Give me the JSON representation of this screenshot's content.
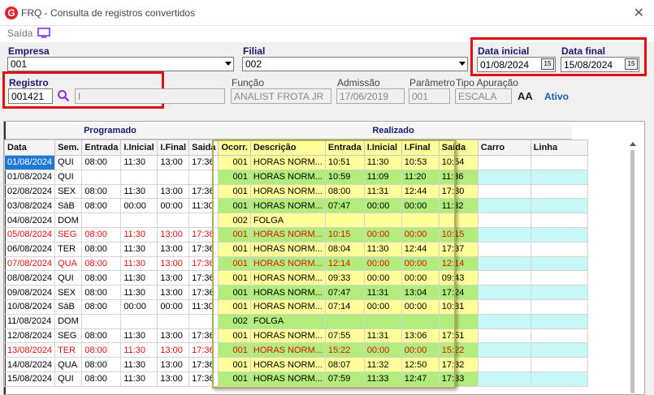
{
  "window": {
    "title": "FRQ - Consulta de registros convertidos",
    "app_icon": "G"
  },
  "toolbar": {
    "saida": "Saída"
  },
  "form": {
    "empresa_label": "Empresa",
    "empresa_value": "001",
    "filial_label": "Filial",
    "filial_value": "002",
    "data_inicial_label": "Data inicial",
    "data_inicial_value": "01/08/2024",
    "data_final_label": "Data final",
    "data_final_value": "15/08/2024",
    "registro_label": "Registro",
    "registro_value": "001421",
    "nome_value": "I",
    "funcao_label": "Função",
    "funcao_value": "ANALIST FROTA JR",
    "admissao_label": "Admissão",
    "admissao_value": "17/06/2019",
    "parametro_label": "Parâmetro",
    "parametro_value": "001",
    "tipo_label": "Tipo Apuração",
    "tipo_value": "ESCALA",
    "status": "Ativo",
    "cal_icon": "15"
  },
  "grid": {
    "group_programado": "Programado",
    "group_realizado": "Realizado",
    "headers": [
      "Data",
      "Sem.",
      "Entrada",
      "I.Inicial",
      "I.Final",
      "Saida",
      "Ocorr.",
      "Descrição",
      "Entrada",
      "I.Inicial",
      "I.Final",
      "Saida",
      "Carro",
      "Linha"
    ],
    "rows": [
      {
        "data": "01/08/2024",
        "sem": "QUI",
        "pe": "08:00",
        "pi": "11:30",
        "pf": "13:00",
        "ps": "17:36",
        "oc": "001",
        "desc": "HORAS NORM...",
        "re": "10:51",
        "ri": "11:30",
        "rf": "10:53",
        "rs": "10:54",
        "red": false,
        "sel": true
      },
      {
        "data": "01/08/2024",
        "sem": "QUI",
        "pe": "",
        "pi": "",
        "pf": "",
        "ps": "",
        "oc": "001",
        "desc": "HORAS NORM...",
        "re": "10:59",
        "ri": "11:09",
        "rf": "11:20",
        "rs": "11:36",
        "red": false
      },
      {
        "data": "02/08/2024",
        "sem": "SEX",
        "pe": "08:00",
        "pi": "11:30",
        "pf": "13:00",
        "ps": "17:36",
        "oc": "001",
        "desc": "HORAS NORM...",
        "re": "08:00",
        "ri": "11:31",
        "rf": "12:44",
        "rs": "17:30",
        "red": false
      },
      {
        "data": "03/08/2024",
        "sem": "SáB",
        "pe": "08:00",
        "pi": "00:00",
        "pf": "00:00",
        "ps": "11:30",
        "oc": "001",
        "desc": "HORAS NORM...",
        "re": "07:47",
        "ri": "00:00",
        "rf": "00:00",
        "rs": "11:32",
        "red": false
      },
      {
        "data": "04/08/2024",
        "sem": "DOM",
        "pe": "",
        "pi": "",
        "pf": "",
        "ps": "",
        "oc": "002",
        "desc": "FOLGA",
        "re": "",
        "ri": "",
        "rf": "",
        "rs": "",
        "red": false
      },
      {
        "data": "05/08/2024",
        "sem": "SEG",
        "pe": "08:00",
        "pi": "11:30",
        "pf": "13:00",
        "ps": "17:36",
        "oc": "001",
        "desc": "HORAS NORM...",
        "re": "10:15",
        "ri": "00:00",
        "rf": "00:00",
        "rs": "10:15",
        "red": true
      },
      {
        "data": "06/08/2024",
        "sem": "TER",
        "pe": "08:00",
        "pi": "11:30",
        "pf": "13:00",
        "ps": "17:36",
        "oc": "001",
        "desc": "HORAS NORM...",
        "re": "08:04",
        "ri": "11:30",
        "rf": "12:44",
        "rs": "17:37",
        "red": false
      },
      {
        "data": "07/08/2024",
        "sem": "QUA",
        "pe": "08:00",
        "pi": "11:30",
        "pf": "13:00",
        "ps": "17:36",
        "oc": "001",
        "desc": "HORAS NORM...",
        "re": "12:14",
        "ri": "00:00",
        "rf": "00:00",
        "rs": "12:14",
        "red": true
      },
      {
        "data": "08/08/2024",
        "sem": "QUI",
        "pe": "08:00",
        "pi": "11:30",
        "pf": "13:00",
        "ps": "17:36",
        "oc": "001",
        "desc": "HORAS NORM...",
        "re": "09:33",
        "ri": "00:00",
        "rf": "00:00",
        "rs": "09:43",
        "red": false
      },
      {
        "data": "09/08/2024",
        "sem": "SEX",
        "pe": "08:00",
        "pi": "11:30",
        "pf": "13:00",
        "ps": "17:36",
        "oc": "001",
        "desc": "HORAS NORM...",
        "re": "07:47",
        "ri": "11:31",
        "rf": "13:04",
        "rs": "17:24",
        "red": false
      },
      {
        "data": "10/08/2024",
        "sem": "SáB",
        "pe": "08:00",
        "pi": "00:00",
        "pf": "00:00",
        "ps": "11:30",
        "oc": "001",
        "desc": "HORAS NORM...",
        "re": "07:14",
        "ri": "00:00",
        "rf": "00:00",
        "rs": "10:31",
        "red": false
      },
      {
        "data": "11/08/2024",
        "sem": "DOM",
        "pe": "",
        "pi": "",
        "pf": "",
        "ps": "",
        "oc": "002",
        "desc": "FOLGA",
        "re": "",
        "ri": "",
        "rf": "",
        "rs": "",
        "red": false
      },
      {
        "data": "12/08/2024",
        "sem": "SEG",
        "pe": "08:00",
        "pi": "11:30",
        "pf": "13:00",
        "ps": "17:36",
        "oc": "001",
        "desc": "HORAS NORM...",
        "re": "07:55",
        "ri": "11:31",
        "rf": "13:06",
        "rs": "17:51",
        "red": false
      },
      {
        "data": "13/08/2024",
        "sem": "TER",
        "pe": "08:00",
        "pi": "11:30",
        "pf": "13:00",
        "ps": "17:36",
        "oc": "001",
        "desc": "HORAS NORM...",
        "re": "15:22",
        "ri": "00:00",
        "rf": "00:00",
        "rs": "15:22",
        "red": true
      },
      {
        "data": "14/08/2024",
        "sem": "QUA",
        "pe": "08:00",
        "pi": "11:30",
        "pf": "13:00",
        "ps": "17:36",
        "oc": "001",
        "desc": "HORAS NORM...",
        "re": "08:07",
        "ri": "11:32",
        "rf": "12:50",
        "rs": "17:32",
        "red": false
      },
      {
        "data": "15/08/2024",
        "sem": "QUI",
        "pe": "08:00",
        "pi": "11:30",
        "pf": "13:00",
        "ps": "17:36",
        "oc": "001",
        "desc": "HORAS NORM...",
        "re": "07:59",
        "ri": "11:33",
        "rf": "12:47",
        "rs": "17:33",
        "red": false
      }
    ]
  },
  "colors": {
    "highlight_red": "#e01010",
    "realizado_yellow": "#ffff99",
    "realizado_green": "#b2ec7a",
    "cyan": "#c8f7f7",
    "selection_blue": "#1e78d6"
  }
}
